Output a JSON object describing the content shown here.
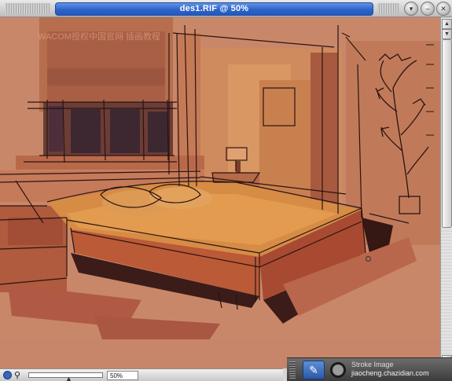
{
  "window": {
    "title": "des1.RIF @ 50%"
  },
  "canvas": {
    "watermark": "WACOM授权中国官网  插画教程"
  },
  "statusbar": {
    "zoom_value": "50%"
  },
  "tooldock": {
    "info_text": "Stroke   Image",
    "site_mark": "jiaocheng.chazidian.com"
  },
  "icons": {
    "close": "close-icon",
    "minimize": "minimize-icon",
    "zoom": "zoom-icon",
    "magnifier": "magnifier-icon",
    "brush": "brush-icon",
    "circle": "circle-brush-icon"
  },
  "colors": {
    "titlebar_accent": "#2d63c8",
    "canvas_wall": "#c9876a",
    "canvas_bed": "#d88a45",
    "canvas_floor": "#b9674c",
    "sketch_line": "#2a1410"
  }
}
